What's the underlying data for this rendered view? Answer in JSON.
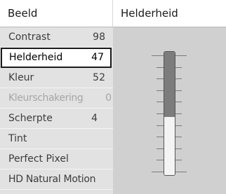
{
  "header": {
    "menu_title": "Beeld",
    "setting_title": "Helderheid"
  },
  "menu": {
    "items": [
      {
        "label": "Contrast",
        "value": "98"
      },
      {
        "label": "Helderheid",
        "value": "47"
      },
      {
        "label": "Kleur",
        "value": "52"
      },
      {
        "label": "Kleurschakering",
        "value": "0"
      },
      {
        "label": "Scherpte",
        "value": "4"
      },
      {
        "label": "Tint",
        "value": ""
      },
      {
        "label": "Perfect Pixel",
        "value": ""
      },
      {
        "label": "HD Natural Motion",
        "value": ""
      }
    ]
  },
  "slider": {
    "level": 0.47
  }
}
